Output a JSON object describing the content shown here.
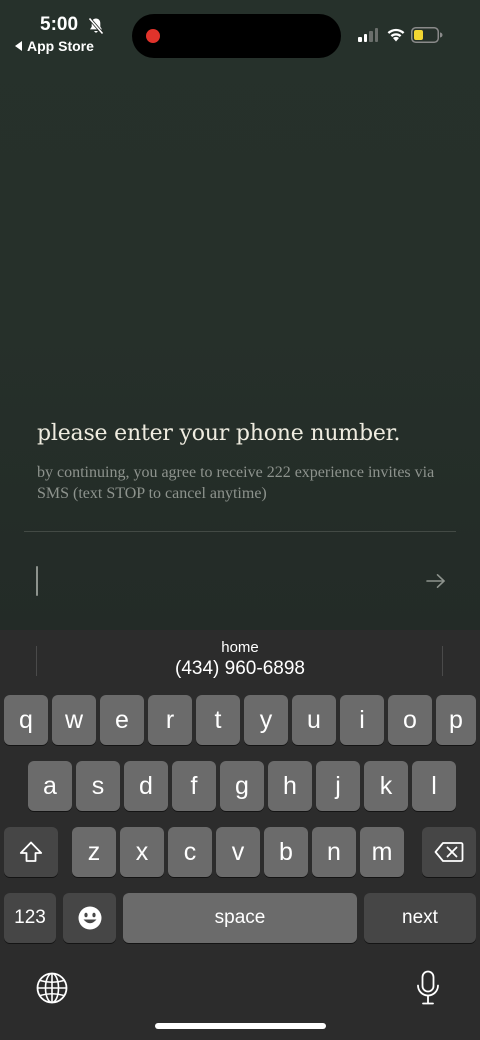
{
  "status_bar": {
    "time": "5:00",
    "back_app": "App Store"
  },
  "signup": {
    "title": "please enter your phone number.",
    "subtitle": "by continuing, you agree to receive 222 experience invites via SMS (text STOP to cancel anytime)",
    "phone_value": "",
    "placeholder": ""
  },
  "keyboard": {
    "suggestion_label": "home",
    "suggestion_value": "(434) 960-6898",
    "row1": [
      "q",
      "w",
      "e",
      "r",
      "t",
      "y",
      "u",
      "i",
      "o",
      "p"
    ],
    "row2": [
      "a",
      "s",
      "d",
      "f",
      "g",
      "h",
      "j",
      "k",
      "l"
    ],
    "row3": [
      "z",
      "x",
      "c",
      "v",
      "b",
      "n",
      "m"
    ],
    "numbers_key": "123",
    "space_key": "space",
    "next_key": "next"
  },
  "colors": {
    "background": "#26302a",
    "title_text": "#efece0",
    "subtitle_text": "#8d938d",
    "record_dot": "#e0332b",
    "battery_low": "#f2d632"
  },
  "icons": [
    "mute-bell-icon",
    "back-arrow-icon",
    "record-dot-icon",
    "signal-icon",
    "wifi-icon",
    "battery-icon",
    "arrow-right-icon",
    "shift-icon",
    "delete-icon",
    "emoji-icon",
    "globe-icon",
    "microphone-icon"
  ]
}
